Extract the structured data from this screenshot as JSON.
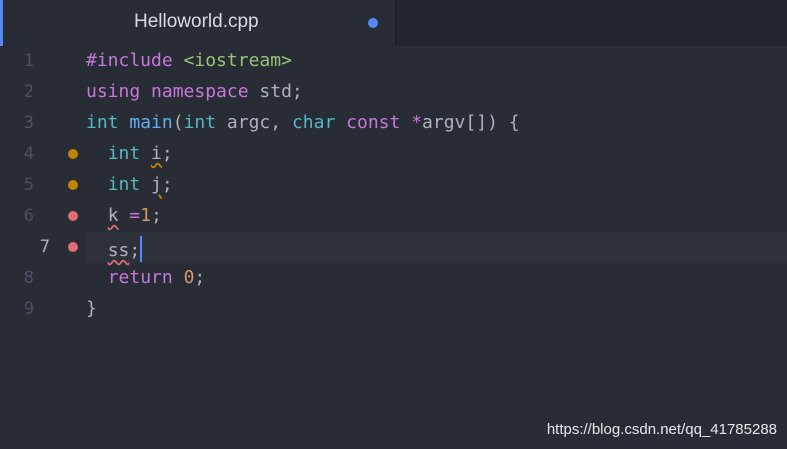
{
  "tab": {
    "title": "Helloworld.cpp",
    "modified": true
  },
  "colors": {
    "accent": "#568af2",
    "warning_marker": "#c18401",
    "error_marker": "#e06c75",
    "keyword": "#c678dd",
    "type": "#56b6c2",
    "function": "#61afef",
    "string": "#98c379",
    "number": "#d19a66"
  },
  "editor": {
    "cursor_line": 7,
    "lines": [
      {
        "num": "1",
        "marker": "none"
      },
      {
        "num": "2",
        "marker": "none"
      },
      {
        "num": "3",
        "marker": "none"
      },
      {
        "num": "4",
        "marker": "warning"
      },
      {
        "num": "5",
        "marker": "warning"
      },
      {
        "num": "6",
        "marker": "error"
      },
      {
        "num": "7",
        "marker": "error"
      },
      {
        "num": "8",
        "marker": "none"
      },
      {
        "num": "9",
        "marker": "none"
      }
    ],
    "tokens": {
      "l1_kw": "#include",
      "l1_hdr": "<iostream>",
      "l2_using": "using",
      "l2_ns": "namespace",
      "l2_std": "std;",
      "l3_int": "int",
      "l3_main": "main",
      "l3_open": "(",
      "l3_int2": "int",
      "l3_argc": "argc,",
      "l3_char": "char",
      "l3_const": "const",
      "l3_star": "*",
      "l3_argv": "argv",
      "l3_close": "[]) {",
      "l4_int": "int",
      "l4_i": "i",
      "l4_semi": ";",
      "l5_int": "int",
      "l5_j": "j",
      "l5_semi": ";",
      "l6_k": "k",
      "l6_eq": "=",
      "l6_one": "1",
      "l6_semi": ";",
      "l7_ss": "ss",
      "l7_semi": ";",
      "l8_return": "return",
      "l8_zero": "0",
      "l8_semi": ";",
      "l9_brace": "}"
    }
  },
  "watermark": "https://blog.csdn.net/qq_41785288"
}
